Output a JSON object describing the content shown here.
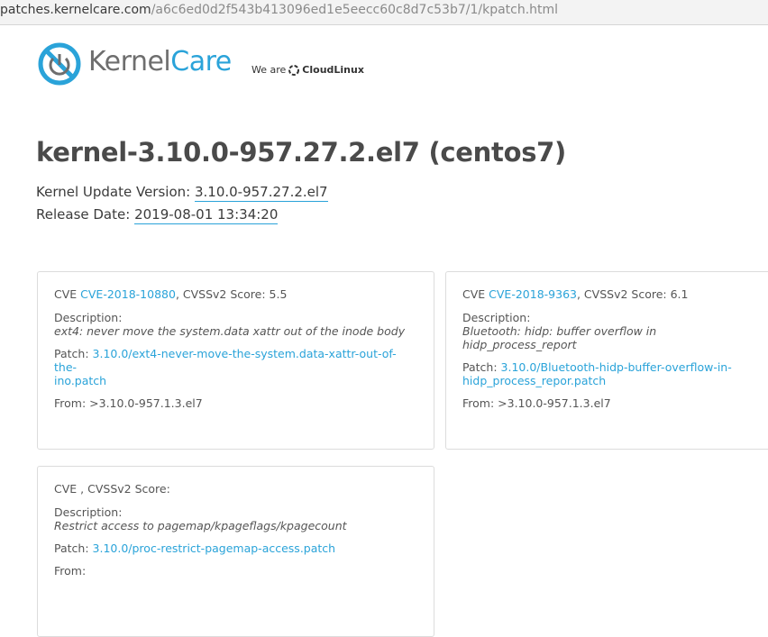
{
  "browser": {
    "url_host": "patches.kernelcare.com",
    "url_path": "/a6c6ed0d2f543b413096ed1e5eecc60c8d7c53b7/1/kpatch.html"
  },
  "logo": {
    "word_part1": "Kernel",
    "word_part2": "Care",
    "we_are": "We are",
    "cloudlinux": "CloudLinux",
    "brand_color": "#2aa3d9"
  },
  "page": {
    "title": "kernel-3.10.0-957.27.2.el7 (centos7)",
    "update_label": "Kernel Update Version: ",
    "update_value": "3.10.0-957.27.2.el7",
    "release_label": "Release Date: ",
    "release_value": "2019-08-01 13:34:20"
  },
  "cards": [
    {
      "cve_prefix": "CVE ",
      "cve_id": "CVE-2018-10880",
      "score_text": ", CVSSv2 Score: 5.5",
      "description_label": "Description:",
      "description": "ext4: never move the system.data xattr out of the inode body",
      "patch_label": "Patch: ",
      "patch_link_line1": "3.10.0/ext4-never-move-the-system.data-xattr-out-of-the-",
      "patch_link_line2": "ino.patch",
      "from_text": "From: >3.10.0-957.1.3.el7"
    },
    {
      "cve_prefix": "CVE ",
      "cve_id": "CVE-2018-9363",
      "score_text": ", CVSSv2 Score: 6.1",
      "description_label": "Description:",
      "description": "Bluetooth: hidp: buffer overflow in hidp_process_report",
      "patch_label": "Patch: ",
      "patch_link_line1": "3.10.0/Bluetooth-hidp-buffer-overflow-in-",
      "patch_link_line2": "hidp_process_repor.patch",
      "from_text": "From: >3.10.0-957.1.3.el7"
    },
    {
      "cve_prefix": "CVE ",
      "cve_id": "",
      "score_text": ", CVSSv2 Score:",
      "description_label": "Description:",
      "description": "Restrict access to pagemap/kpageflags/kpagecount",
      "patch_label": "Patch: ",
      "patch_link_line1": "3.10.0/proc-restrict-pagemap-access.patch",
      "patch_link_line2": "",
      "from_text": "From:"
    }
  ]
}
